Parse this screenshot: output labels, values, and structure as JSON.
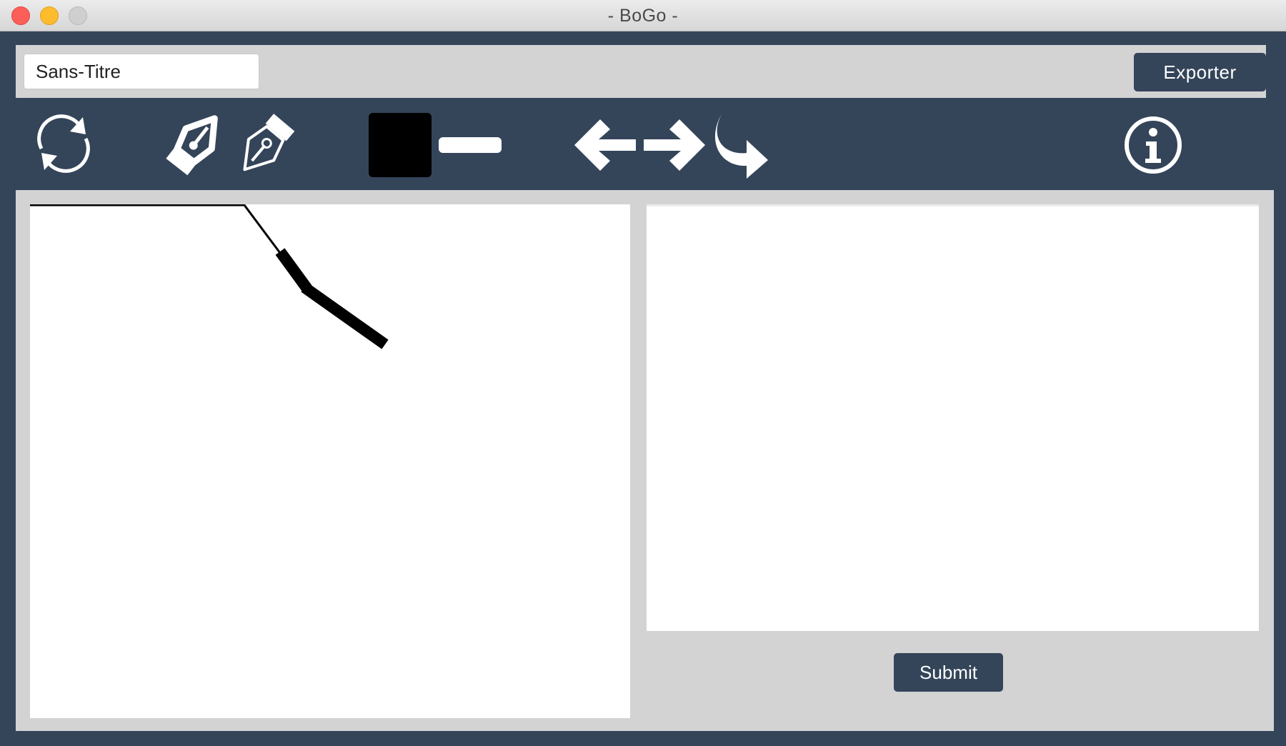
{
  "window": {
    "title": "- BoGo -"
  },
  "header": {
    "document_title_value": "Sans-Titre",
    "export_label": "Exporter"
  },
  "toolbar": {
    "tools": [
      {
        "name": "refresh-icon"
      },
      {
        "name": "pen-nib-icon"
      },
      {
        "name": "pen-nib-outline-icon"
      },
      {
        "name": "color-swatch",
        "color": "#000000"
      },
      {
        "name": "stroke-size-icon"
      },
      {
        "name": "arrow-left-icon"
      },
      {
        "name": "arrow-right-icon"
      },
      {
        "name": "redo-icon"
      },
      {
        "name": "info-icon"
      }
    ]
  },
  "submit_label": "Submit",
  "colors": {
    "frame": "#34455a",
    "panel": "#d3d3d3",
    "selected_color": "#000000"
  }
}
